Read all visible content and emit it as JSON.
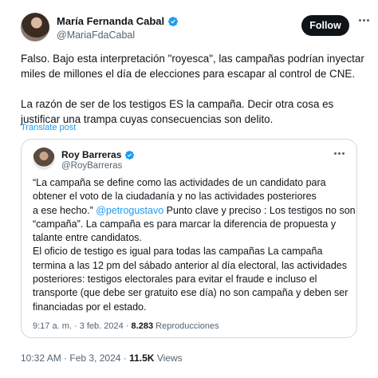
{
  "author": {
    "name": "María Fernanda Cabal",
    "handle": "@MariaFdaCabal",
    "verified_color": "#1d9bf0"
  },
  "follow_label": "Follow",
  "body": [
    "Falso. Bajo esta interpretación \"royesca\",  las campañas  podrían inyectar",
    "miles de millones el día de elecciones para escapar al control de CNE.",
    "La razón de ser de los testigos ES la campaña. Decir otra cosa es",
    "justificar una trampa cuyas consecuencias son delito."
  ],
  "translate_label": "Translate post",
  "quote": {
    "name": "Roy Barreras",
    "handle": "@RoyBarreras",
    "lines": [
      {
        "text": "“La campaña se define como las actividades de un candidato para"
      },
      {
        "text": "obtener el voto de la ciudadanía y no las actividades posteriores"
      },
      {
        "text": "a ese hecho.” ",
        "mention": "@petrogustavo",
        "after": " Punto clave y preciso : Los testigos no son"
      },
      {
        "text": "“campaña”. La campaña es para marcar la diferencia de propuesta y"
      },
      {
        "text": "talante entre candidatos."
      },
      {
        "text": "El oficio de testigo es igual para todas las campañas La campaña"
      },
      {
        "text": "termina a las 12 pm del sábado anterior al día electoral, las actividades"
      },
      {
        "text": "posteriores: testigos electorales para  evitar el fraude e incluso el"
      },
      {
        "text": "transporte (que debe ser gratuito ese día) no son campaña y deben ser"
      },
      {
        "text": "financiadas por el estado."
      }
    ],
    "time": "9:17 a. m.",
    "date": "3 feb. 2024",
    "views_count": "8.283",
    "views_label": "Reproducciones"
  },
  "footer": {
    "time": "10:32 AM",
    "date": "Feb 3, 2024",
    "views_count": "11.5K",
    "views_label": "Views"
  }
}
